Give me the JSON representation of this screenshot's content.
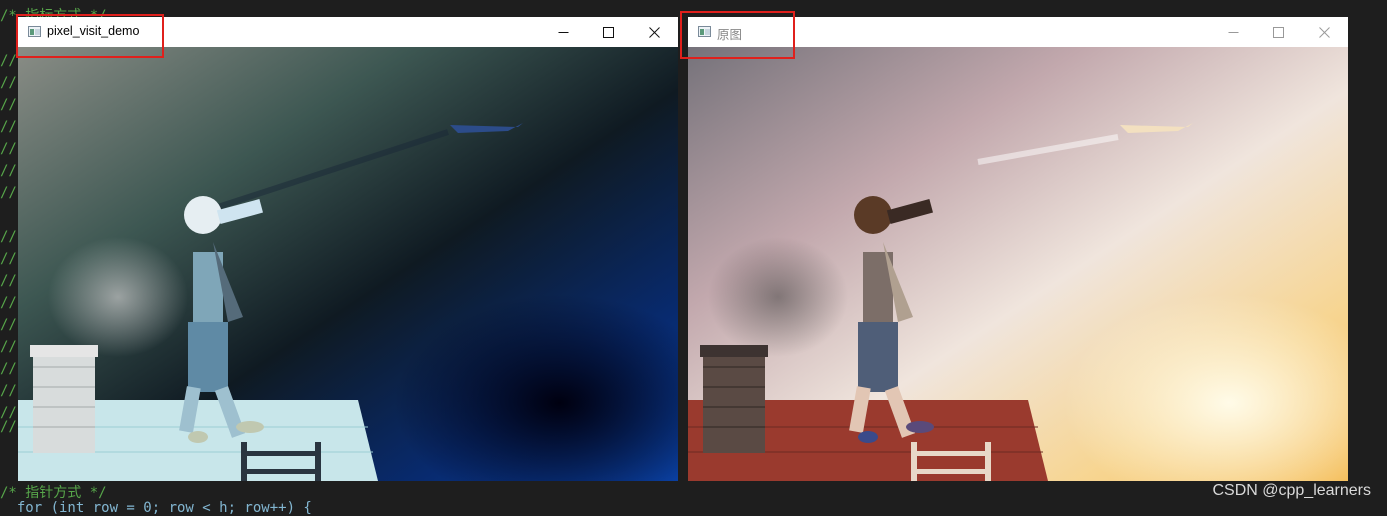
{
  "editor": {
    "top_comment": "/* 指标方式 */",
    "bottom_comment": "/* 指针方式 */",
    "bottom_code": "  for (int row = 0; row < h; row++) {",
    "gutter_marks": [
      "//",
      "//",
      "//",
      "//",
      "//",
      "//",
      "//",
      "//",
      "//",
      "//",
      "//",
      "//",
      "//",
      "//",
      "//",
      "//",
      "//",
      "//",
      "//}"
    ]
  },
  "window_left": {
    "title": "pixel_visit_demo",
    "icon": "opencv-window-icon",
    "controls": {
      "minimize": "minimize-icon",
      "maximize": "maximize-icon",
      "close": "close-icon"
    },
    "image": "inverted-color-child-on-roof-with-binoculars"
  },
  "window_right": {
    "title": "原图",
    "icon": "opencv-window-icon",
    "controls": {
      "minimize": "minimize-icon",
      "maximize": "maximize-icon",
      "close": "close-icon"
    },
    "image": "original-child-on-roof-with-binoculars-sunset"
  },
  "annotations": {
    "highlight_color": "#e0201c"
  },
  "watermark": "CSDN @cpp_learners"
}
